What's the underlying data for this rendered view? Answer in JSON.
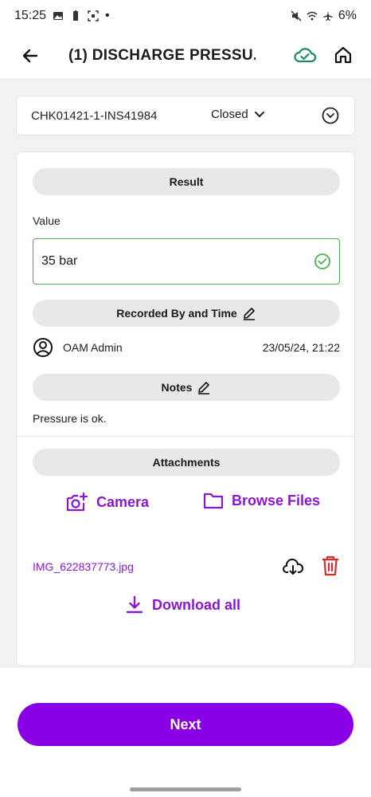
{
  "status_bar": {
    "time": "15:25",
    "dot": "•",
    "battery": "6%"
  },
  "app_bar": {
    "title": "(1) DISCHARGE PRESSU..."
  },
  "check": {
    "id": "CHK01421-1-INS41984",
    "status": "Closed"
  },
  "result": {
    "header": "Result",
    "value_label": "Value",
    "value": "35 bar"
  },
  "recorded": {
    "header": "Recorded By and Time",
    "user": "OAM Admin",
    "timestamp": "23/05/24, 21:22"
  },
  "notes": {
    "header": "Notes",
    "text": "Pressure is ok."
  },
  "attachments": {
    "header": "Attachments",
    "camera_label": "Camera",
    "browse_label": "Browse Files",
    "files": [
      {
        "name": "IMG_622837773.jpg"
      }
    ],
    "download_all_label": "Download all"
  },
  "footer": {
    "next_label": "Next"
  },
  "colors": {
    "accent": "#8a00e6",
    "link": "#8a17cf",
    "success": "#4caf50",
    "sync_cloud": "#1e8a5e",
    "delete": "#d32f2f"
  },
  "icons": {
    "back": "arrow-left-icon",
    "sync": "cloud-check-icon",
    "home": "home-icon",
    "expand": "chevron-circle-down-icon",
    "valid": "check-circle-icon",
    "edit": "pencil-icon",
    "user": "user-circle-icon",
    "camera": "camera-plus-icon",
    "folder": "folder-icon",
    "file_download": "cloud-download-icon",
    "delete": "trash-icon",
    "download_all": "download-icon"
  }
}
